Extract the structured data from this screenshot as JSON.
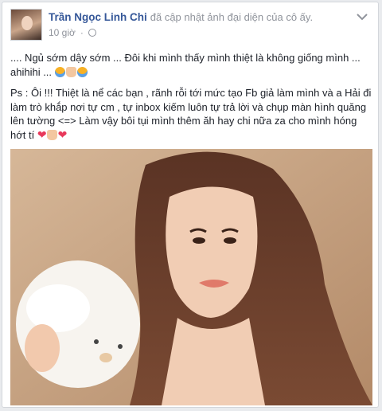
{
  "post": {
    "author": "Trần Ngọc Linh Chi",
    "action": "đã cập nhật ảnh đại diện của cô ấy.",
    "time": "10 giờ",
    "paragraph1_text": ".... Ngủ sớm dậy sớm ... Đôi khi mình thấy mình thiệt là không giống mình ... ahihihi ...",
    "paragraph2_text": "Ps : Ôi !!! Thiệt là nể các bạn , rãnh rỗi tới mức tạo Fb giả làm mình và a Hải đi làm trò khắp nơi tự cm , tự inbox kiếm luôn tự trả lời và chụp màn hình quăng lên tường <=> Làm vậy bôi tụi mình thêm ăh hay chi nữa za cho mình hóng hớt tí",
    "icons": {
      "privacy": "globe-icon",
      "options": "chevron-down-icon",
      "emoji1": "laughing-emoji-icon",
      "emoji2": "praying-hands-emoji-icon",
      "emoji3": "heart-emoji-icon"
    }
  }
}
